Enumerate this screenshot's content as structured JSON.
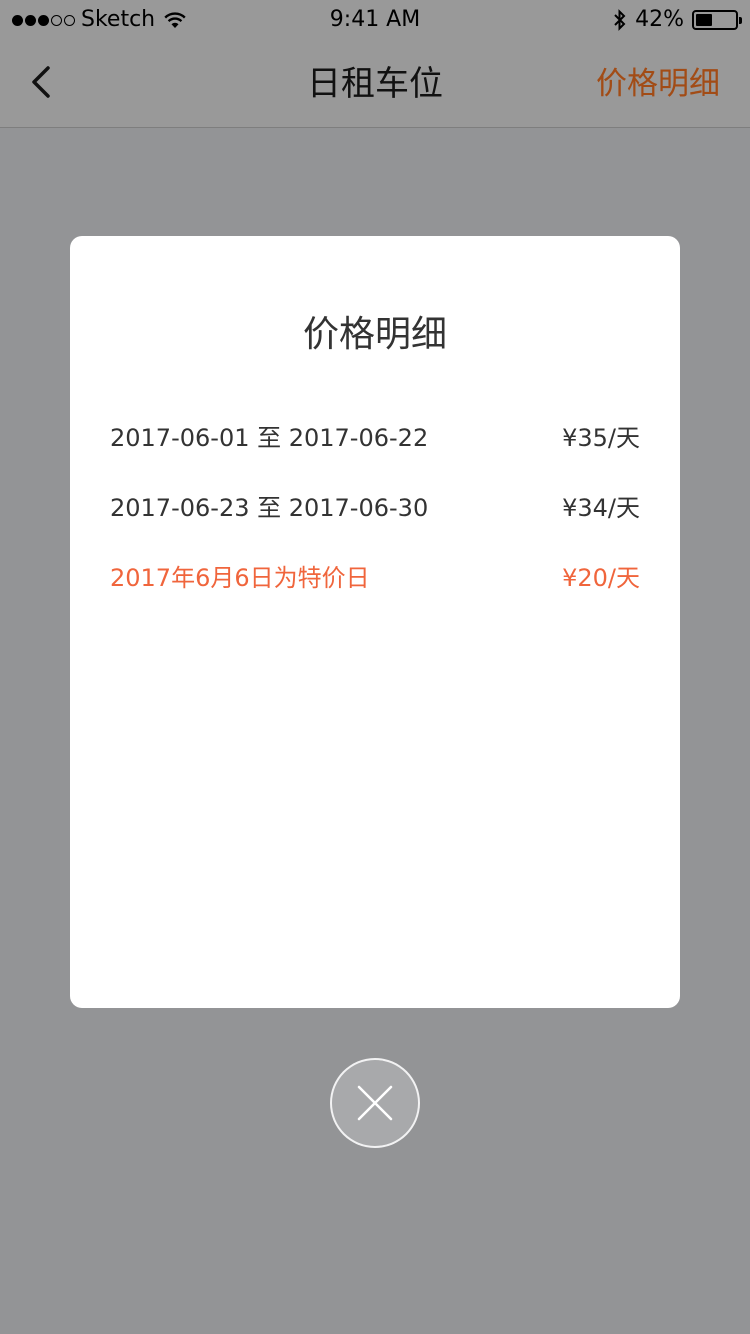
{
  "status_bar": {
    "carrier": "Sketch",
    "time": "9:41 AM",
    "battery_percent": "42%",
    "battery_level": 0.42,
    "signal_bars_filled": 3,
    "signal_bars_total": 5,
    "icons": [
      "wifi-icon",
      "bluetooth-icon",
      "battery-icon"
    ]
  },
  "nav": {
    "title": "日租车位",
    "action_label": "价格明细",
    "action_color": "#a24c16",
    "back_icon": "chevron-left-icon"
  },
  "modal": {
    "title": "价格明细",
    "rows": [
      {
        "range": "2017-06-01 至 2017-06-22",
        "price": "¥35/天",
        "special": false
      },
      {
        "range": "2017-06-23 至 2017-06-30",
        "price": "¥34/天",
        "special": false
      },
      {
        "range": "2017年6月6日为特价日",
        "price": "¥20/天",
        "special": true
      }
    ],
    "special_color": "#f0653c"
  },
  "close_button": {
    "icon": "close-icon"
  }
}
